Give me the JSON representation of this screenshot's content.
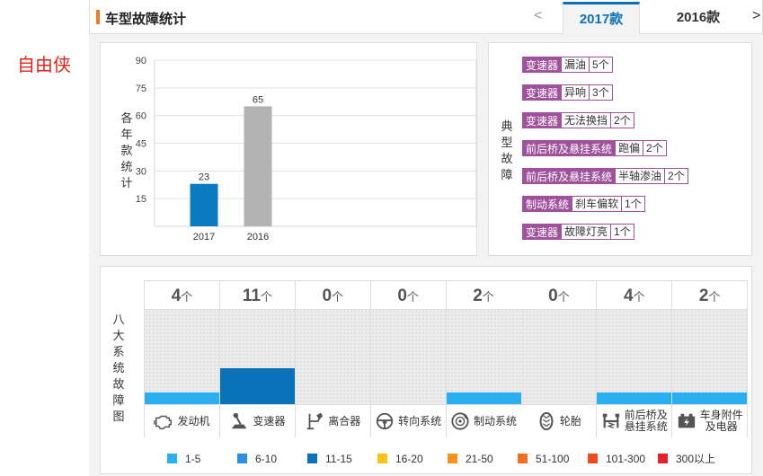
{
  "brand": "自由侠",
  "header": {
    "title": "车型故障统计",
    "prev_icon": "chevron-left-icon",
    "prev_glyph": "<",
    "next_icon": "chevron-right-icon",
    "next_glyph": ">",
    "tabs": [
      {
        "label": "2017款",
        "active": true
      },
      {
        "label": "2016款",
        "active": false
      }
    ],
    "accent": "#0b70b9",
    "marker_color": "#f47920"
  },
  "chart_data": {
    "type": "bar",
    "categories": [
      "2017",
      "2016"
    ],
    "values": [
      23,
      65
    ],
    "colors": [
      "#0a7bc1",
      "#b3b3b3"
    ],
    "ylabel": "各年款统计",
    "yticks": [
      15,
      30,
      45,
      60,
      75,
      90
    ],
    "ylim": [
      0,
      90
    ],
    "grid": true
  },
  "faults": {
    "label": "典型故障",
    "items": [
      {
        "system": "变速器",
        "type": "漏油",
        "count": "5个"
      },
      {
        "system": "变速器",
        "type": "异响",
        "count": "3个"
      },
      {
        "system": "变速器",
        "type": "无法换挡",
        "count": "2个"
      },
      {
        "system": "前后桥及悬挂系统",
        "type": "跑偏",
        "count": "2个"
      },
      {
        "system": "前后桥及悬挂系统",
        "type": "半轴渗油",
        "count": "2个"
      },
      {
        "system": "制动系统",
        "type": "刹车偏软",
        "count": "1个"
      },
      {
        "system": "变速器",
        "type": "故障灯亮",
        "count": "1个"
      }
    ],
    "color": "#a0519c"
  },
  "systems": {
    "label": "八大系统故障图",
    "unit": "个",
    "items": [
      {
        "name": "发动机",
        "count": "4",
        "level": "1-5",
        "icon": "engine-icon"
      },
      {
        "name": "变速器",
        "count": "11",
        "level": "11-15",
        "icon": "gearshift-icon"
      },
      {
        "name": "离合器",
        "count": "0",
        "level": "",
        "icon": "clutch-pedal-icon"
      },
      {
        "name": "转向系统",
        "count": "0",
        "level": "",
        "icon": "steering-wheel-icon"
      },
      {
        "name": "制动系统",
        "count": "2",
        "level": "1-5",
        "icon": "brake-disc-icon"
      },
      {
        "name": "轮胎",
        "count": "0",
        "level": "",
        "icon": "tire-icon"
      },
      {
        "name": "前后桥及悬挂系统",
        "name_lines": [
          "前后桥及",
          "悬挂系统"
        ],
        "count": "4",
        "level": "1-5",
        "icon": "suspension-icon"
      },
      {
        "name": "车身附件及电器",
        "name_lines": [
          "车身附件",
          "及电器"
        ],
        "count": "2",
        "level": "1-5",
        "icon": "battery-icon"
      }
    ]
  },
  "legend": [
    {
      "label": "1-5",
      "color": "#2ab0f0"
    },
    {
      "label": "6-10",
      "color": "#2d8fe6"
    },
    {
      "label": "11-15",
      "color": "#0a72b9"
    },
    {
      "label": "16-20",
      "color": "#f9c419"
    },
    {
      "label": "21-50",
      "color": "#f7931e"
    },
    {
      "label": "51-100",
      "color": "#f26f21"
    },
    {
      "label": "101-300",
      "color": "#ee4b21"
    },
    {
      "label": "300以上",
      "color": "#e7212a"
    }
  ]
}
